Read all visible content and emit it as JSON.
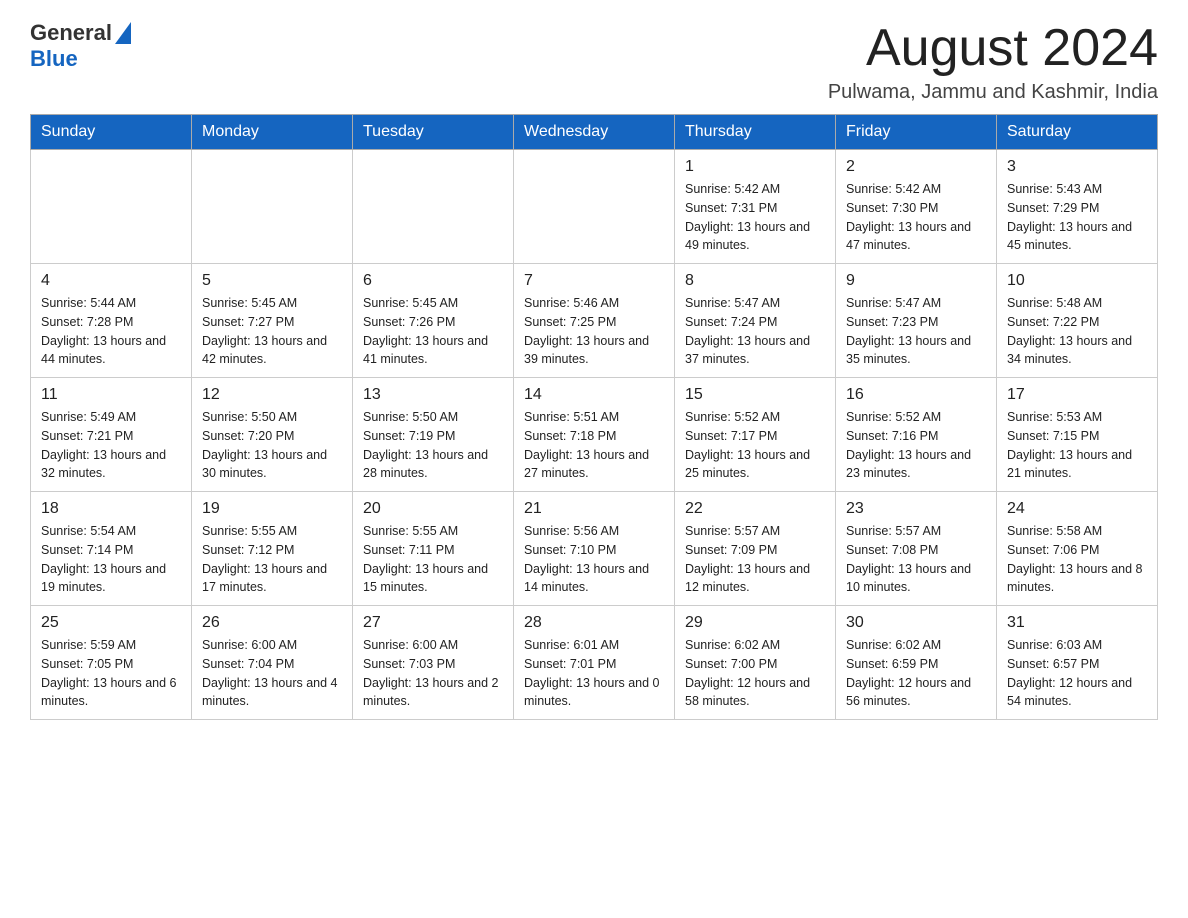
{
  "header": {
    "logo_general": "General",
    "logo_blue": "Blue",
    "month_title": "August 2024",
    "location": "Pulwama, Jammu and Kashmir, India"
  },
  "weekdays": [
    "Sunday",
    "Monday",
    "Tuesday",
    "Wednesday",
    "Thursday",
    "Friday",
    "Saturday"
  ],
  "weeks": [
    [
      {
        "day": "",
        "sunrise": "",
        "sunset": "",
        "daylight": ""
      },
      {
        "day": "",
        "sunrise": "",
        "sunset": "",
        "daylight": ""
      },
      {
        "day": "",
        "sunrise": "",
        "sunset": "",
        "daylight": ""
      },
      {
        "day": "",
        "sunrise": "",
        "sunset": "",
        "daylight": ""
      },
      {
        "day": "1",
        "sunrise": "Sunrise: 5:42 AM",
        "sunset": "Sunset: 7:31 PM",
        "daylight": "Daylight: 13 hours and 49 minutes."
      },
      {
        "day": "2",
        "sunrise": "Sunrise: 5:42 AM",
        "sunset": "Sunset: 7:30 PM",
        "daylight": "Daylight: 13 hours and 47 minutes."
      },
      {
        "day": "3",
        "sunrise": "Sunrise: 5:43 AM",
        "sunset": "Sunset: 7:29 PM",
        "daylight": "Daylight: 13 hours and 45 minutes."
      }
    ],
    [
      {
        "day": "4",
        "sunrise": "Sunrise: 5:44 AM",
        "sunset": "Sunset: 7:28 PM",
        "daylight": "Daylight: 13 hours and 44 minutes."
      },
      {
        "day": "5",
        "sunrise": "Sunrise: 5:45 AM",
        "sunset": "Sunset: 7:27 PM",
        "daylight": "Daylight: 13 hours and 42 minutes."
      },
      {
        "day": "6",
        "sunrise": "Sunrise: 5:45 AM",
        "sunset": "Sunset: 7:26 PM",
        "daylight": "Daylight: 13 hours and 41 minutes."
      },
      {
        "day": "7",
        "sunrise": "Sunrise: 5:46 AM",
        "sunset": "Sunset: 7:25 PM",
        "daylight": "Daylight: 13 hours and 39 minutes."
      },
      {
        "day": "8",
        "sunrise": "Sunrise: 5:47 AM",
        "sunset": "Sunset: 7:24 PM",
        "daylight": "Daylight: 13 hours and 37 minutes."
      },
      {
        "day": "9",
        "sunrise": "Sunrise: 5:47 AM",
        "sunset": "Sunset: 7:23 PM",
        "daylight": "Daylight: 13 hours and 35 minutes."
      },
      {
        "day": "10",
        "sunrise": "Sunrise: 5:48 AM",
        "sunset": "Sunset: 7:22 PM",
        "daylight": "Daylight: 13 hours and 34 minutes."
      }
    ],
    [
      {
        "day": "11",
        "sunrise": "Sunrise: 5:49 AM",
        "sunset": "Sunset: 7:21 PM",
        "daylight": "Daylight: 13 hours and 32 minutes."
      },
      {
        "day": "12",
        "sunrise": "Sunrise: 5:50 AM",
        "sunset": "Sunset: 7:20 PM",
        "daylight": "Daylight: 13 hours and 30 minutes."
      },
      {
        "day": "13",
        "sunrise": "Sunrise: 5:50 AM",
        "sunset": "Sunset: 7:19 PM",
        "daylight": "Daylight: 13 hours and 28 minutes."
      },
      {
        "day": "14",
        "sunrise": "Sunrise: 5:51 AM",
        "sunset": "Sunset: 7:18 PM",
        "daylight": "Daylight: 13 hours and 27 minutes."
      },
      {
        "day": "15",
        "sunrise": "Sunrise: 5:52 AM",
        "sunset": "Sunset: 7:17 PM",
        "daylight": "Daylight: 13 hours and 25 minutes."
      },
      {
        "day": "16",
        "sunrise": "Sunrise: 5:52 AM",
        "sunset": "Sunset: 7:16 PM",
        "daylight": "Daylight: 13 hours and 23 minutes."
      },
      {
        "day": "17",
        "sunrise": "Sunrise: 5:53 AM",
        "sunset": "Sunset: 7:15 PM",
        "daylight": "Daylight: 13 hours and 21 minutes."
      }
    ],
    [
      {
        "day": "18",
        "sunrise": "Sunrise: 5:54 AM",
        "sunset": "Sunset: 7:14 PM",
        "daylight": "Daylight: 13 hours and 19 minutes."
      },
      {
        "day": "19",
        "sunrise": "Sunrise: 5:55 AM",
        "sunset": "Sunset: 7:12 PM",
        "daylight": "Daylight: 13 hours and 17 minutes."
      },
      {
        "day": "20",
        "sunrise": "Sunrise: 5:55 AM",
        "sunset": "Sunset: 7:11 PM",
        "daylight": "Daylight: 13 hours and 15 minutes."
      },
      {
        "day": "21",
        "sunrise": "Sunrise: 5:56 AM",
        "sunset": "Sunset: 7:10 PM",
        "daylight": "Daylight: 13 hours and 14 minutes."
      },
      {
        "day": "22",
        "sunrise": "Sunrise: 5:57 AM",
        "sunset": "Sunset: 7:09 PM",
        "daylight": "Daylight: 13 hours and 12 minutes."
      },
      {
        "day": "23",
        "sunrise": "Sunrise: 5:57 AM",
        "sunset": "Sunset: 7:08 PM",
        "daylight": "Daylight: 13 hours and 10 minutes."
      },
      {
        "day": "24",
        "sunrise": "Sunrise: 5:58 AM",
        "sunset": "Sunset: 7:06 PM",
        "daylight": "Daylight: 13 hours and 8 minutes."
      }
    ],
    [
      {
        "day": "25",
        "sunrise": "Sunrise: 5:59 AM",
        "sunset": "Sunset: 7:05 PM",
        "daylight": "Daylight: 13 hours and 6 minutes."
      },
      {
        "day": "26",
        "sunrise": "Sunrise: 6:00 AM",
        "sunset": "Sunset: 7:04 PM",
        "daylight": "Daylight: 13 hours and 4 minutes."
      },
      {
        "day": "27",
        "sunrise": "Sunrise: 6:00 AM",
        "sunset": "Sunset: 7:03 PM",
        "daylight": "Daylight: 13 hours and 2 minutes."
      },
      {
        "day": "28",
        "sunrise": "Sunrise: 6:01 AM",
        "sunset": "Sunset: 7:01 PM",
        "daylight": "Daylight: 13 hours and 0 minutes."
      },
      {
        "day": "29",
        "sunrise": "Sunrise: 6:02 AM",
        "sunset": "Sunset: 7:00 PM",
        "daylight": "Daylight: 12 hours and 58 minutes."
      },
      {
        "day": "30",
        "sunrise": "Sunrise: 6:02 AM",
        "sunset": "Sunset: 6:59 PM",
        "daylight": "Daylight: 12 hours and 56 minutes."
      },
      {
        "day": "31",
        "sunrise": "Sunrise: 6:03 AM",
        "sunset": "Sunset: 6:57 PM",
        "daylight": "Daylight: 12 hours and 54 minutes."
      }
    ]
  ]
}
